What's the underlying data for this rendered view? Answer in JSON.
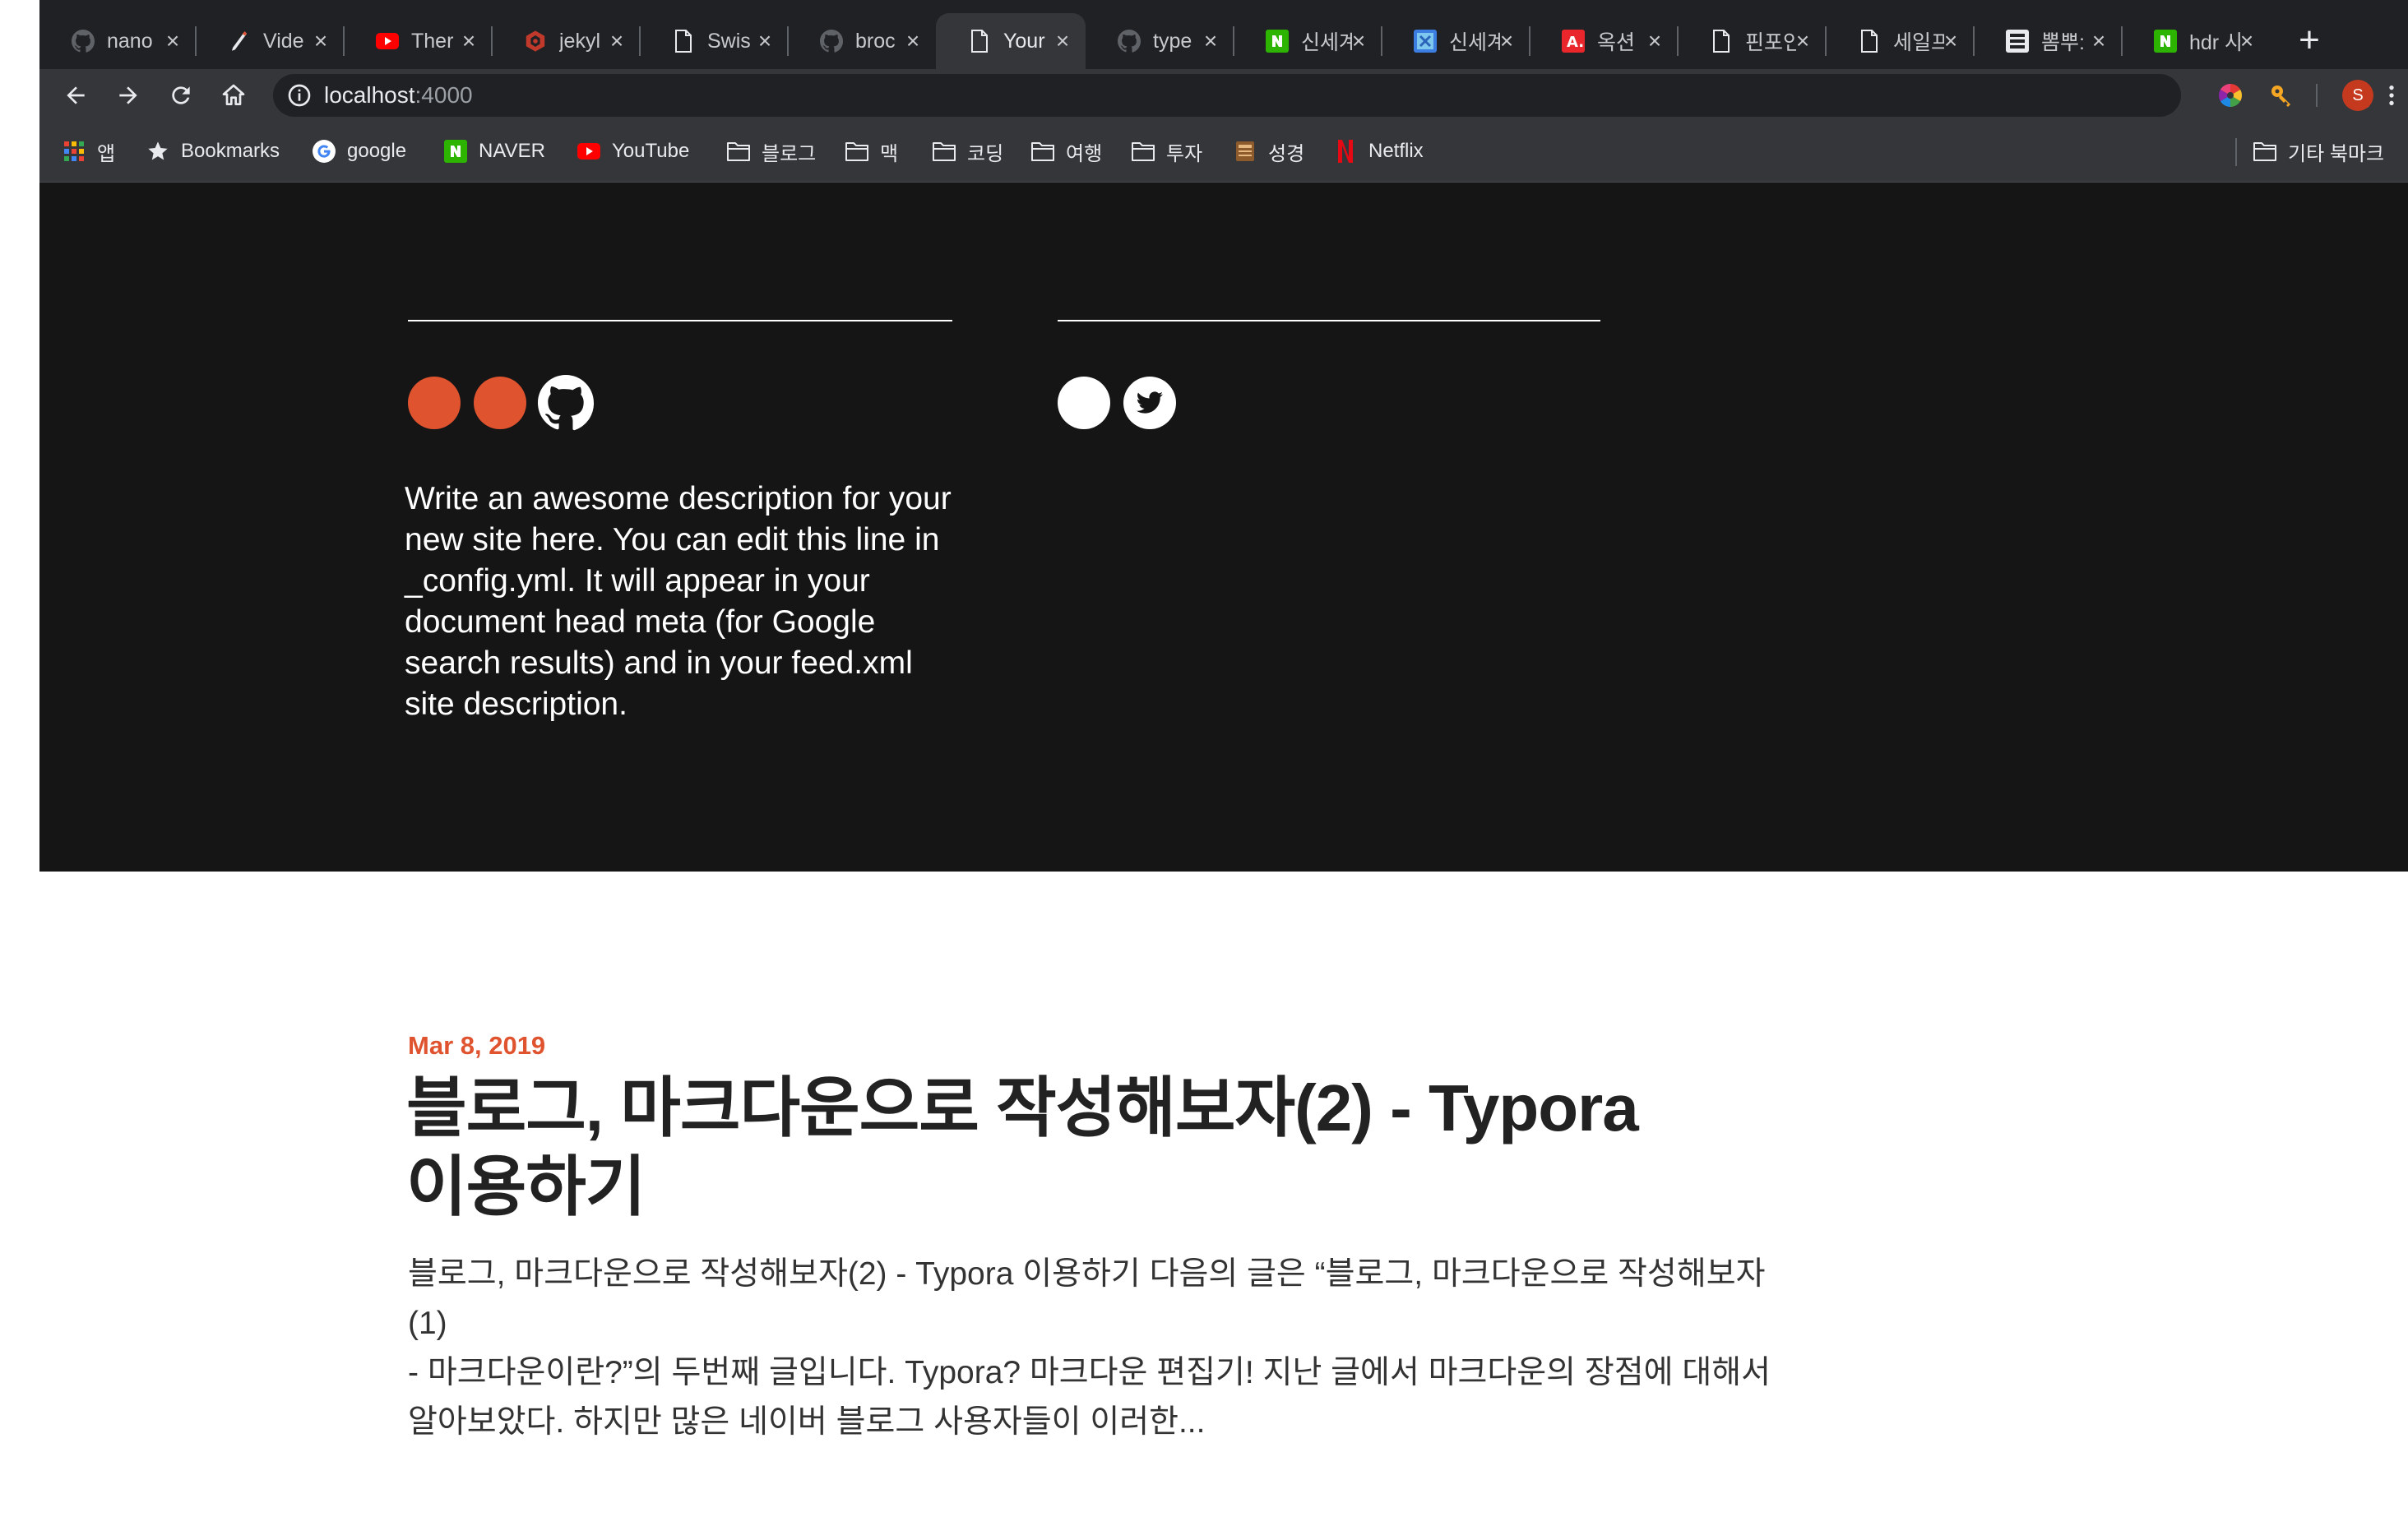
{
  "browser": {
    "tabs": [
      {
        "title": "nano",
        "icon": "github-icon",
        "active": false
      },
      {
        "title": "Vide",
        "icon": "pen-icon",
        "active": false
      },
      {
        "title": "Ther",
        "icon": "youtube-icon",
        "active": false
      },
      {
        "title": "jekyl",
        "icon": "jekyll-icon",
        "active": false
      },
      {
        "title": "Swis",
        "icon": "page-icon",
        "active": false
      },
      {
        "title": "broc",
        "icon": "github-icon",
        "active": false
      },
      {
        "title": "Your",
        "icon": "page-icon",
        "active": true
      },
      {
        "title": "type",
        "icon": "github-icon",
        "active": false
      },
      {
        "title": "신세계",
        "icon": "naver-icon",
        "active": false
      },
      {
        "title": "신세계",
        "icon": "xls-icon",
        "active": false
      },
      {
        "title": "옥션",
        "icon": "auction-icon",
        "active": false
      },
      {
        "title": "핀포인",
        "icon": "page-icon",
        "active": false
      },
      {
        "title": "세일프",
        "icon": "page-icon",
        "active": false
      },
      {
        "title": "뽐뿌:",
        "icon": "ppomppu-icon",
        "active": false
      },
      {
        "title": "hdr 사",
        "icon": "naver-icon",
        "active": false
      }
    ],
    "new_tab_label": "+",
    "address": {
      "host": "localhost",
      "port": ":4000"
    },
    "profile_initial": "S",
    "bookmarks": [
      {
        "label": "앱",
        "icon": "apps-grid-icon"
      },
      {
        "label": "Bookmarks",
        "icon": "star-icon"
      },
      {
        "label": "google",
        "icon": "google-icon"
      },
      {
        "label": "NAVER",
        "icon": "naver-icon"
      },
      {
        "label": "YouTube",
        "icon": "youtube-icon"
      },
      {
        "label": "블로그",
        "icon": "folder-icon"
      },
      {
        "label": "맥",
        "icon": "folder-icon"
      },
      {
        "label": "코딩",
        "icon": "folder-icon"
      },
      {
        "label": "여행",
        "icon": "folder-icon"
      },
      {
        "label": "투자",
        "icon": "folder-icon"
      },
      {
        "label": "성경",
        "icon": "bible-icon"
      },
      {
        "label": "Netflix",
        "icon": "netflix-icon"
      }
    ],
    "other_bookmarks": "기타 북마크"
  },
  "header": {
    "description": "Write an awesome description for your new site here. You can edit this line in _config.yml. It will appear in your document head meta (for Google search results) and in your feed.xml site description.",
    "social_left": [
      "social-circle",
      "social-circle",
      "github-icon"
    ],
    "social_right": [
      "social-circle",
      "twitter-icon"
    ]
  },
  "post": {
    "date": "Mar 8, 2019",
    "title_line1": "블로그, 마크다운으로 작성해보자(2) - Typora",
    "title_line2": "이용하기",
    "excerpt_line1": "블로그, 마크다운으로 작성해보자(2) - Typora 이용하기 다음의 글은 “블로그, 마크다운으로 작성해보자(1)",
    "excerpt_line2": "- 마크다운이란?”의 두번째 글입니다. Typora? 마크다운 편집기! 지난 글에서 마크다운의 장점에 대해서",
    "excerpt_line3": "알아보았다. 하지만 많은 네이버 블로그 사용자들이 이러한..."
  },
  "colors": {
    "accent": "#e0532f",
    "header_bg": "#151515",
    "chrome_bg": "#202124",
    "toolbar_bg": "#35363a"
  }
}
